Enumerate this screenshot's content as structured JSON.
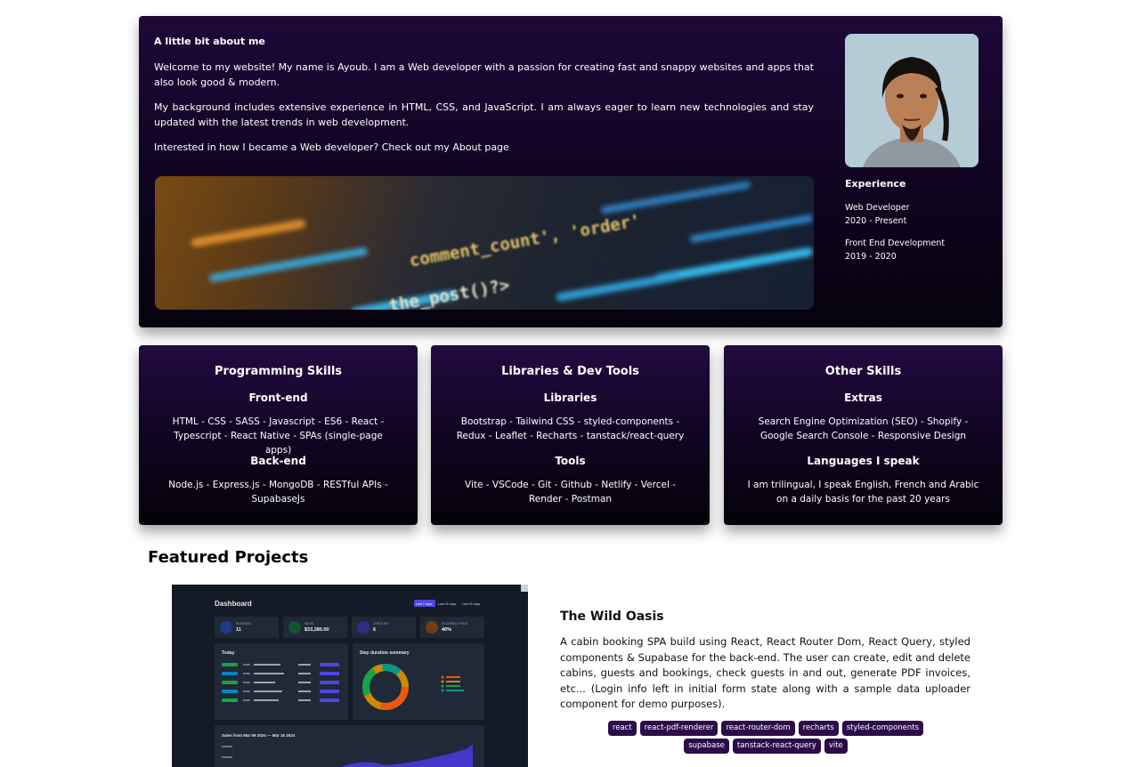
{
  "about": {
    "title": "A little bit about me",
    "paragraphs": [
      "Welcome to my website! My name is Ayoub. I am a Web developer with a passion for creating fast and snappy websites and apps that also look good & modern.",
      "My background includes extensive experience in HTML, CSS, and JavaScript. I am always eager to learn new technologies and stay updated with the latest trends in web development.",
      "Interested in how I became a Web developer? Check out my About page"
    ],
    "code_snippet": [
      "comment_count', 'order'",
      "the_post()?>"
    ]
  },
  "experience": {
    "title": "Experience",
    "items": [
      {
        "role": "Web Developer",
        "period": "2020 - Present"
      },
      {
        "role": "Front End Development",
        "period": "2019 - 2020"
      }
    ]
  },
  "skills": [
    {
      "title": "Programming Skills",
      "sections": [
        {
          "heading": "Front-end",
          "text": "HTML - CSS - SASS - Javascript - ES6 - React - Typescript - React Native - SPAs (single-page apps)"
        },
        {
          "heading": "Back-end",
          "text": "Node.js - Express.js - MongoDB - RESTful APIs - SupabaseJs"
        }
      ]
    },
    {
      "title": "Libraries & Dev Tools",
      "sections": [
        {
          "heading": "Libraries",
          "text": "Bootstrap - Tailwind CSS - styled-components - Redux - Leaflet - Recharts - tanstack/react-query"
        },
        {
          "heading": "Tools",
          "text": "Vite - VSCode - Git - Github - Netlify - Vercel - Render - Postman"
        }
      ]
    },
    {
      "title": "Other Skills",
      "sections": [
        {
          "heading": "Extras",
          "text": "Search Engine Optimization (SEO) - Shopify - Google Search Console - Responsive Design"
        },
        {
          "heading": "Languages I speak",
          "text": "I am trilingual, I speak English, French and Arabic on a daily basis for the past 20 years"
        }
      ]
    }
  ],
  "featured_title": "Featured Projects",
  "project": {
    "title": "The Wild Oasis",
    "description": "A cabin booking SPA build using React, React Router Dom, React Query, styled components & Supabase for the back-end. The user can create, edit and delete cabins, guests and bookings, check guests in and out, generate PDF invoices, etc... (Login info left in initial form state along with a sample data uploader component for demo purposes).",
    "tags": [
      "react",
      "react-pdf-renderer",
      "react-router-dom",
      "recharts",
      "styled-components",
      "supabase",
      "tanstack-react-query",
      "vite"
    ],
    "screenshot": {
      "heading": "Dashboard",
      "filters": [
        "Last 7 days",
        "Last 30 days",
        "Last 90 days"
      ],
      "stats": [
        {
          "label": "BOOKINGS",
          "value": "11"
        },
        {
          "label": "SALES",
          "value": "$33,285.00"
        },
        {
          "label": "CHECK INS",
          "value": "6"
        },
        {
          "label": "OCCUPANCY RATE",
          "value": "40%"
        }
      ],
      "today_title": "Today",
      "summary_title": "Stay duration summary",
      "sales_title": "Sales from Mar 09 2024 — Mar 15 2024",
      "colors": {
        "blue": "#4f46e5",
        "green": "#16a34a",
        "orange": "#ea580c",
        "yellow": "#ca8a04",
        "teal": "#0d9488"
      }
    }
  }
}
